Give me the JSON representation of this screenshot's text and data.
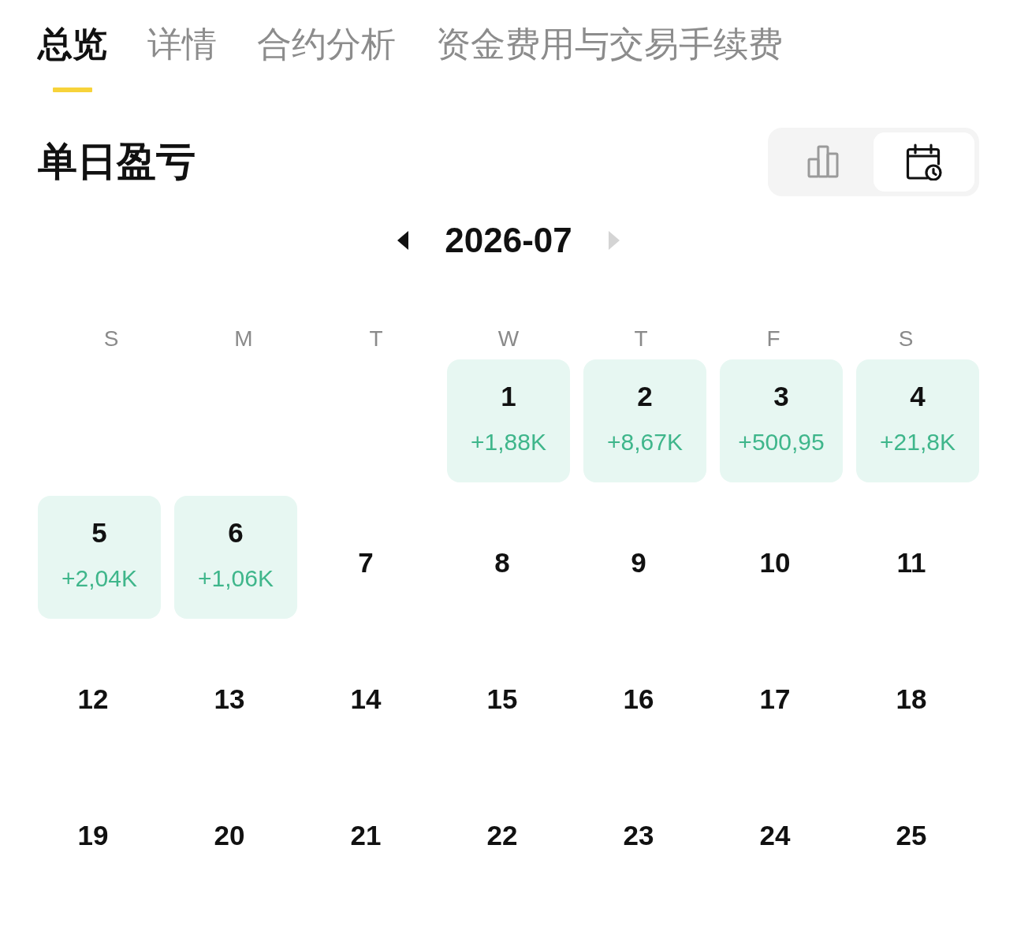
{
  "tabs": [
    {
      "label": "总览",
      "selected": true
    },
    {
      "label": "详情",
      "selected": false
    },
    {
      "label": "合约分析",
      "selected": false
    },
    {
      "label": "资金费用与交易手续费",
      "selected": false
    }
  ],
  "section": {
    "title": "单日盈亏",
    "view_toggle": [
      {
        "kind": "bar_chart",
        "selected": false
      },
      {
        "kind": "calendar",
        "selected": true
      }
    ]
  },
  "calendar": {
    "month": "2026-07",
    "prev": {
      "disabled": false
    },
    "next": {
      "disabled": true
    },
    "weekdays": [
      "S",
      "M",
      "T",
      "W",
      "T",
      "F",
      "S"
    ],
    "weeks": [
      [
        {
          "day": "1",
          "pnl": "+1,88K"
        },
        {
          "day": "2",
          "pnl": "+8,67K"
        },
        {
          "day": "3",
          "pnl": "+500,95"
        },
        {
          "day": "4",
          "pnl": "+21,8K"
        }
      ],
      [
        {
          "day": "5",
          "pnl": "+2,04K"
        },
        {
          "day": "6",
          "pnl": "+1,06K"
        },
        {
          "day": "7"
        },
        {
          "day": "8"
        },
        {
          "day": "9"
        },
        {
          "day": "10"
        },
        {
          "day": "11"
        }
      ],
      [
        {
          "day": "12"
        },
        {
          "day": "13"
        },
        {
          "day": "14"
        },
        {
          "day": "15"
        },
        {
          "day": "16"
        },
        {
          "day": "17"
        },
        {
          "day": "18"
        }
      ],
      [
        {
          "day": "19"
        },
        {
          "day": "20"
        },
        {
          "day": "21"
        },
        {
          "day": "22"
        },
        {
          "day": "23"
        },
        {
          "day": "24"
        },
        {
          "day": "25"
        }
      ]
    ]
  }
}
